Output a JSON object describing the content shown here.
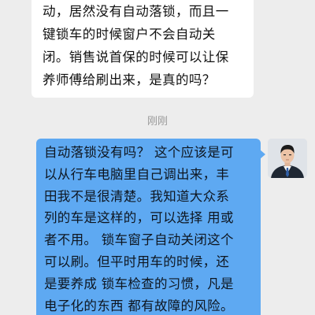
{
  "incoming_message": {
    "lines": [
      "动，居然没有自动落锁，而且一",
      "键锁车的时候窗户不会自动关",
      "闭。销售说首保的时候可以让保",
      "养师傅给刷出来，是真的吗？"
    ]
  },
  "timestamp": "刚刚",
  "outgoing_message": {
    "lines": [
      "自动落锁没有吗？ 这个应该是可",
      "以从行车电脑里自己调出来，丰",
      "田我不是很清楚。我知道大众系",
      "列的车是这样的，可以选择  用或",
      "者不用。 锁车窗子自动关闭这个",
      "可以刷。但平时用车的时候，还",
      "是要养成 锁车检查的习惯，凡是",
      "电子化的东西 都有故障的风险。"
    ]
  },
  "colors": {
    "background": "#ededed",
    "incoming_bubble": "#ffffff",
    "outgoing_bubble": "#5ea9f2",
    "timestamp_text": "#9a9a9a"
  }
}
